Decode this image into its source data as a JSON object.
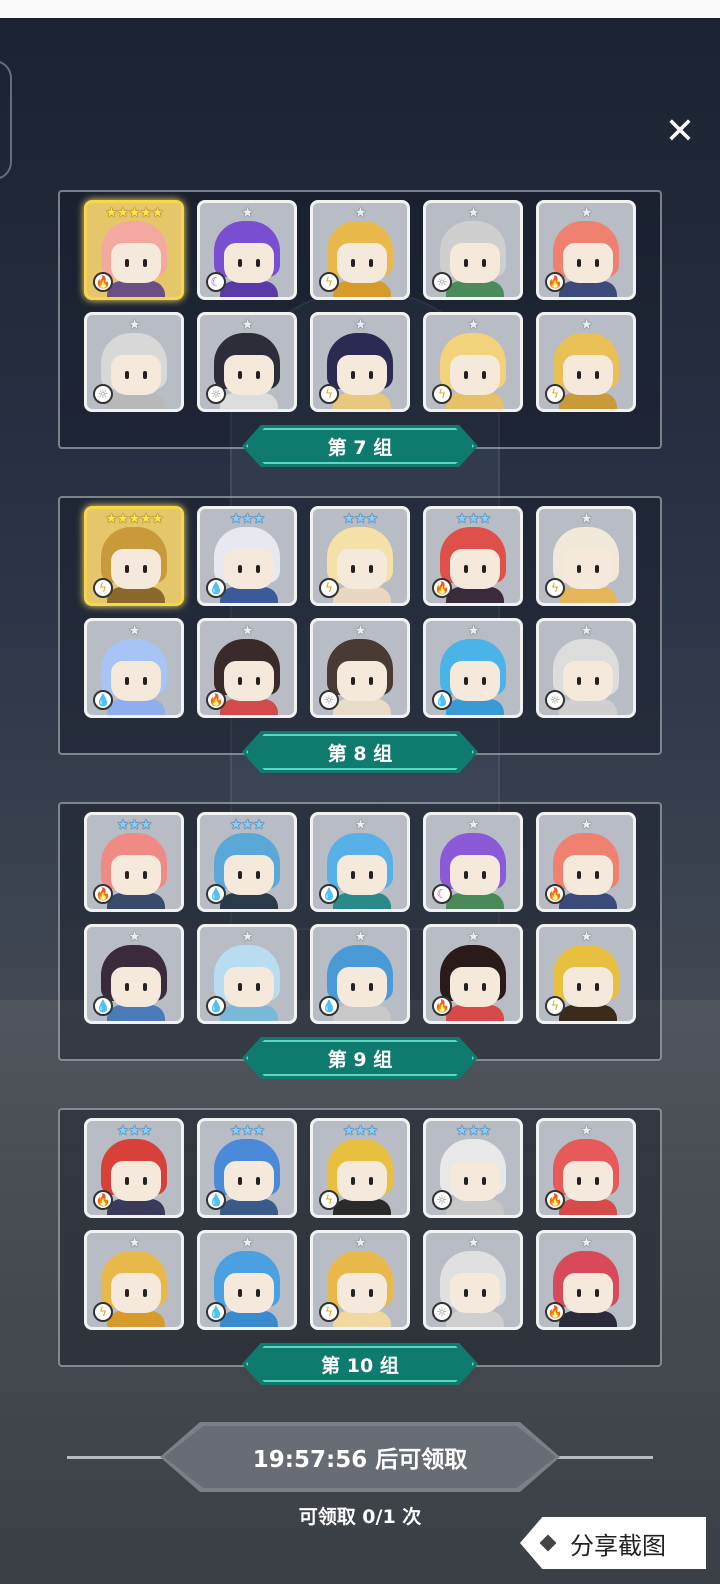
{
  "close_label": "✕",
  "colors": {
    "label_teal": "#0f7b6f",
    "label_teal_border": "#5fd6c4",
    "card_gold": "#f7d64a",
    "claim_button": "#676c75"
  },
  "groups": [
    {
      "label": "第 7 组",
      "cards": [
        {
          "stars": "★★★★★",
          "star_color": "gold",
          "element": "fire",
          "element_icon": "🔥",
          "hair": "#f4a9a0",
          "body": "#6a4e86",
          "highlight": true
        },
        {
          "stars": "★",
          "star_color": "silver",
          "element": "dark",
          "element_icon": "☾",
          "hair": "#7a4ed1",
          "body": "#5a3aa8",
          "highlight": false
        },
        {
          "stars": "★",
          "star_color": "silver",
          "element": "thunder",
          "element_icon": "ϟ",
          "hair": "#e8b84a",
          "body": "#d79b2c",
          "highlight": false
        },
        {
          "stars": "★",
          "star_color": "silver",
          "element": "light",
          "element_icon": "☼",
          "hair": "#cfcfcf",
          "body": "#4b8a5a",
          "highlight": false
        },
        {
          "stars": "★",
          "star_color": "silver",
          "element": "fire",
          "element_icon": "🔥",
          "hair": "#f08070",
          "body": "#3a4a7a",
          "highlight": false
        },
        {
          "stars": "★",
          "star_color": "silver",
          "element": "light",
          "element_icon": "☼",
          "hair": "#d8d8d8",
          "body": "#b8b8b8",
          "highlight": false
        },
        {
          "stars": "★",
          "star_color": "silver",
          "element": "light",
          "element_icon": "☼",
          "hair": "#2d2d3a",
          "body": "#dcdcdc",
          "highlight": false
        },
        {
          "stars": "★",
          "star_color": "silver",
          "element": "thunder",
          "element_icon": "ϟ",
          "hair": "#2b2a52",
          "body": "#e8c87a",
          "highlight": false
        },
        {
          "stars": "★",
          "star_color": "silver",
          "element": "thunder",
          "element_icon": "ϟ",
          "hair": "#f2d27a",
          "body": "#e7c16a",
          "highlight": false
        },
        {
          "stars": "★",
          "star_color": "silver",
          "element": "thunder",
          "element_icon": "ϟ",
          "hair": "#e8c056",
          "body": "#c99a3a",
          "highlight": false
        }
      ]
    },
    {
      "label": "第 8 组",
      "cards": [
        {
          "stars": "★★★★★",
          "star_color": "gold",
          "element": "thunder",
          "element_icon": "ϟ",
          "hair": "#c89a3a",
          "body": "#8a6a2a",
          "highlight": true
        },
        {
          "stars": "★★★",
          "star_color": "blue",
          "element": "water",
          "element_icon": "💧",
          "hair": "#e8e8f0",
          "body": "#3a5a9a",
          "highlight": false
        },
        {
          "stars": "★★★",
          "star_color": "blue",
          "element": "thunder",
          "element_icon": "ϟ",
          "hair": "#f5e0a8",
          "body": "#e9d7c2",
          "highlight": false
        },
        {
          "stars": "★★★",
          "star_color": "blue",
          "element": "fire",
          "element_icon": "🔥",
          "hair": "#e0504a",
          "body": "#3a2a3a",
          "highlight": false
        },
        {
          "stars": "★",
          "star_color": "silver",
          "element": "thunder",
          "element_icon": "ϟ",
          "hair": "#f0e8d8",
          "body": "#e4b65a",
          "highlight": false
        },
        {
          "stars": "★",
          "star_color": "silver",
          "element": "water",
          "element_icon": "💧",
          "hair": "#a8c4f4",
          "body": "#8eaef0",
          "highlight": false
        },
        {
          "stars": "★",
          "star_color": "silver",
          "element": "fire",
          "element_icon": "🔥",
          "hair": "#3a2a2a",
          "body": "#d24a4a",
          "highlight": false
        },
        {
          "stars": "★",
          "star_color": "silver",
          "element": "light",
          "element_icon": "☼",
          "hair": "#4a3a34",
          "body": "#e8dcc8",
          "highlight": false
        },
        {
          "stars": "★",
          "star_color": "silver",
          "element": "water",
          "element_icon": "💧",
          "hair": "#4ab4e8",
          "body": "#3a9ad8",
          "highlight": false
        },
        {
          "stars": "★",
          "star_color": "silver",
          "element": "light",
          "element_icon": "☼",
          "hair": "#dcdcdc",
          "body": "#cfcfcf",
          "highlight": false
        }
      ]
    },
    {
      "label": "第 9 组",
      "cards": [
        {
          "stars": "★★★",
          "star_color": "blue",
          "element": "fire",
          "element_icon": "🔥",
          "hair": "#f08a84",
          "body": "#3a4a6a",
          "highlight": false
        },
        {
          "stars": "★★★",
          "star_color": "blue",
          "element": "water",
          "element_icon": "💧",
          "hair": "#5aa8d8",
          "body": "#2a3a4a",
          "highlight": false
        },
        {
          "stars": "★",
          "star_color": "silver",
          "element": "water",
          "element_icon": "💧",
          "hair": "#58b0e8",
          "body": "#2a8a8a",
          "highlight": false
        },
        {
          "stars": "★",
          "star_color": "silver",
          "element": "dark",
          "element_icon": "☾",
          "hair": "#8a5ad8",
          "body": "#4a8a5a",
          "highlight": false
        },
        {
          "stars": "★",
          "star_color": "silver",
          "element": "fire",
          "element_icon": "🔥",
          "hair": "#f08070",
          "body": "#3a4a7a",
          "highlight": false
        },
        {
          "stars": "★",
          "star_color": "silver",
          "element": "water",
          "element_icon": "💧",
          "hair": "#3a2a3a",
          "body": "#4a7ab8",
          "highlight": false
        },
        {
          "stars": "★",
          "star_color": "silver",
          "element": "water",
          "element_icon": "💧",
          "hair": "#b8dcf0",
          "body": "#7ab8d8",
          "highlight": false
        },
        {
          "stars": "★",
          "star_color": "silver",
          "element": "water",
          "element_icon": "💧",
          "hair": "#4a9ad8",
          "body": "#c8c8c8",
          "highlight": false
        },
        {
          "stars": "★",
          "star_color": "silver",
          "element": "fire",
          "element_icon": "🔥",
          "hair": "#2a1a1a",
          "body": "#d84a4a",
          "highlight": false
        },
        {
          "stars": "★",
          "star_color": "silver",
          "element": "thunder",
          "element_icon": "ϟ",
          "hair": "#e8c040",
          "body": "#3a2a1a",
          "highlight": false
        }
      ]
    },
    {
      "label": "第 10 组",
      "cards": [
        {
          "stars": "★★★",
          "star_color": "blue",
          "element": "fire",
          "element_icon": "🔥",
          "hair": "#d8403a",
          "body": "#3a3a5a",
          "highlight": false
        },
        {
          "stars": "★★★",
          "star_color": "blue",
          "element": "water",
          "element_icon": "💧",
          "hair": "#4a8ad8",
          "body": "#3a5a8a",
          "highlight": false
        },
        {
          "stars": "★★★",
          "star_color": "blue",
          "element": "thunder",
          "element_icon": "ϟ",
          "hair": "#e8c040",
          "body": "#2a2a2a",
          "highlight": false
        },
        {
          "stars": "★★★",
          "star_color": "blue",
          "element": "light",
          "element_icon": "☼",
          "hair": "#e8e8e8",
          "body": "#c8c8c8",
          "highlight": false
        },
        {
          "stars": "★",
          "star_color": "silver",
          "element": "fire",
          "element_icon": "🔥",
          "hair": "#e85a5a",
          "body": "#d84a4a",
          "highlight": false
        },
        {
          "stars": "★",
          "star_color": "silver",
          "element": "thunder",
          "element_icon": "ϟ",
          "hair": "#e8b84a",
          "body": "#d79b2c",
          "highlight": false
        },
        {
          "stars": "★",
          "star_color": "silver",
          "element": "water",
          "element_icon": "💧",
          "hair": "#4aa0e0",
          "body": "#3a8ad0",
          "highlight": false
        },
        {
          "stars": "★",
          "star_color": "silver",
          "element": "thunder",
          "element_icon": "ϟ",
          "hair": "#e8b84a",
          "body": "#f0d8a0",
          "highlight": false
        },
        {
          "stars": "★",
          "star_color": "silver",
          "element": "light",
          "element_icon": "☼",
          "hair": "#e0e0e0",
          "body": "#cfcfcf",
          "highlight": false
        },
        {
          "stars": "★",
          "star_color": "silver",
          "element": "fire",
          "element_icon": "🔥",
          "hair": "#d84a5a",
          "body": "#2a2a3a",
          "highlight": false
        }
      ]
    }
  ],
  "claim": {
    "timer_label": "19:57:56 后可领取",
    "count_label": "可领取 0/1 次"
  },
  "share": {
    "label": "分享截图"
  }
}
